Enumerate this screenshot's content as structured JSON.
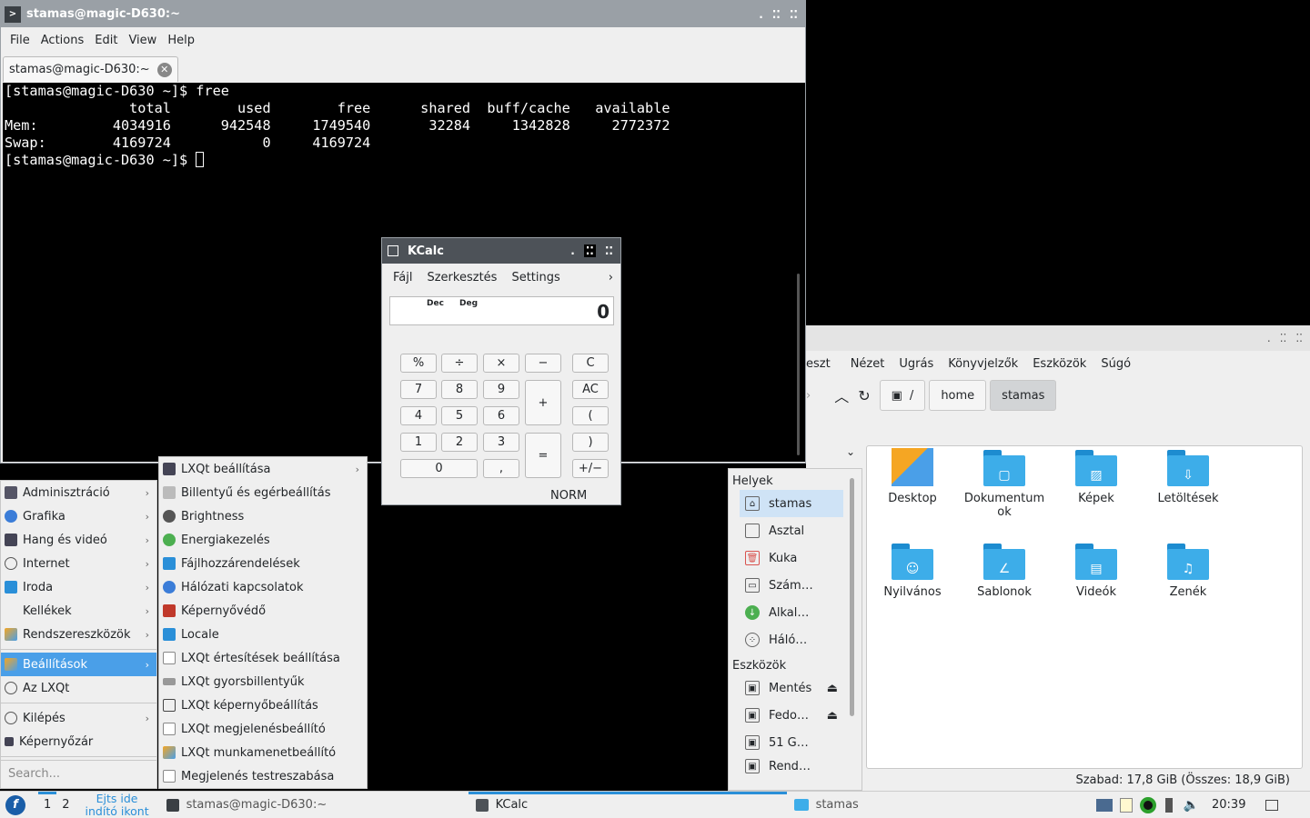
{
  "terminal": {
    "title": "stamas@magic-D630:~",
    "menu": [
      "File",
      "Actions",
      "Edit",
      "View",
      "Help"
    ],
    "tab": "stamas@magic-D630:~",
    "lines": [
      "[stamas@magic-D630 ~]$ free",
      "               total        used        free      shared  buff/cache   available",
      "Mem:         4034916      942548     1749540       32284     1342828     2772372",
      "Swap:        4169724           0     4169724",
      "[stamas@magic-D630 ~]$ "
    ]
  },
  "kcalc": {
    "title": "KCalc",
    "menu": [
      "Fájl",
      "Szerkesztés",
      "Settings"
    ],
    "mode1": "Dec",
    "mode2": "Deg",
    "display": "0",
    "keys": {
      "pct": "%",
      "div": "÷",
      "mul": "×",
      "sub": "−",
      "c": "C",
      "k7": "7",
      "k8": "8",
      "k9": "9",
      "plus": "+",
      "ac": "AC",
      "k4": "4",
      "k5": "5",
      "k6": "6",
      "lp": "(",
      "k1": "1",
      "k2": "2",
      "k3": "3",
      "eq": "=",
      "rp": ")",
      "k0": "0",
      "dot": ",",
      "pm": "+/−"
    },
    "status": "NORM"
  },
  "filemanager": {
    "menu": [
      "eszt",
      "Nézet",
      "Ugrás",
      "Könyvjelzők",
      "Eszközök",
      "Súgó"
    ],
    "crumbs": [
      "/",
      "home",
      "stamas"
    ],
    "items": [
      "Desktop",
      "Dokumentum ok",
      "Képek",
      "Letöltések",
      "Nyilvános",
      "Sablonok",
      "Videók",
      "Zenék"
    ],
    "status": "Szabad: 17,8 GiB (Összes: 18,9 GiB)",
    "places_header": "Helyek",
    "places": [
      "stamas",
      "Asztal",
      "Kuka",
      "Szám…",
      "Alkal…",
      "Háló…"
    ],
    "devices_header": "Eszközök",
    "devices": [
      "Mentés",
      "Fedo…",
      "51 G…",
      "Rend…"
    ]
  },
  "menu": {
    "categories": [
      "Adminisztráció",
      "Grafika",
      "Hang és videó",
      "Internet",
      "Iroda",
      "Kellékek",
      "Rendszereszközök",
      "Beállítások",
      "Az LXQt",
      "Kilépés",
      "Képernyőzár"
    ],
    "search_placeholder": "Search...",
    "settings": [
      "LXQt beállítása",
      "Billentyű és egérbeállítás",
      "Brightness",
      "Energiakezelés",
      "Fájlhozzárendelések",
      "Hálózati kapcsolatok",
      "Képernyővédő",
      "Locale",
      "LXQt értesítések beállítása",
      "LXQt gyorsbillentyűk",
      "LXQt képernyőbeállítás",
      "LXQt megjelenésbeállító",
      "LXQt munkamenetbeállító",
      "Megjelenés testreszabása"
    ]
  },
  "taskbar": {
    "desk1": "1",
    "desk2": "2",
    "quicklaunch": "Ejts ide\nindító ikont",
    "tasks": [
      "stamas@magic-D630:~",
      "KCalc",
      "stamas"
    ],
    "clock": "20:39"
  }
}
